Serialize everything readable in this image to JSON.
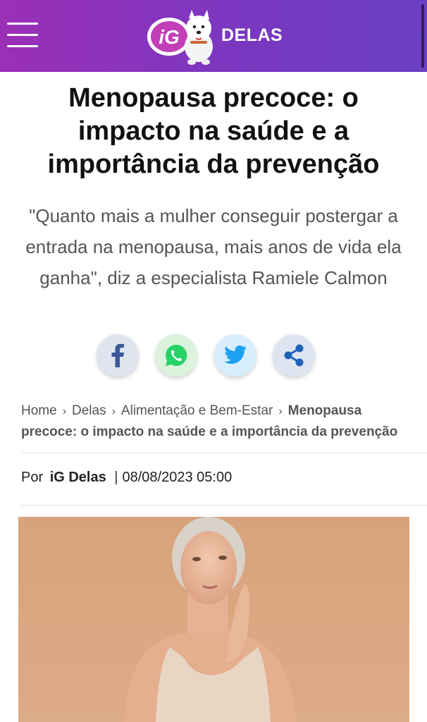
{
  "header": {
    "brand": "DELAS",
    "logo_text": "iG",
    "colors": {
      "gradient_start": "#9b2fb6",
      "gradient_end": "#6a3fc4"
    }
  },
  "article": {
    "title": "Menopausa precoce: o impacto na saúde e a importância da prevenção",
    "subtitle": "\"Quanto mais a mulher conseguir postergar a entrada na menopausa, mais anos de vida ela ganha\", diz a especialista Ramiele Calmon",
    "share": [
      {
        "name": "facebook-icon",
        "color": "#3b5998"
      },
      {
        "name": "whatsapp-icon",
        "color": "#25d366"
      },
      {
        "name": "twitter-icon",
        "color": "#1da1f2"
      },
      {
        "name": "share-icon",
        "color": "#1e63b8"
      }
    ],
    "breadcrumb": {
      "items": [
        "Home",
        "Delas",
        "Alimentação e Bem-Estar"
      ],
      "separator": "›",
      "current": "Menopausa precoce: o impacto na saúde e a importância da prevenção"
    },
    "byline": {
      "prefix": "Por",
      "author": "iG Delas",
      "separator": "|",
      "datetime": "08/08/2023 05:00"
    }
  }
}
